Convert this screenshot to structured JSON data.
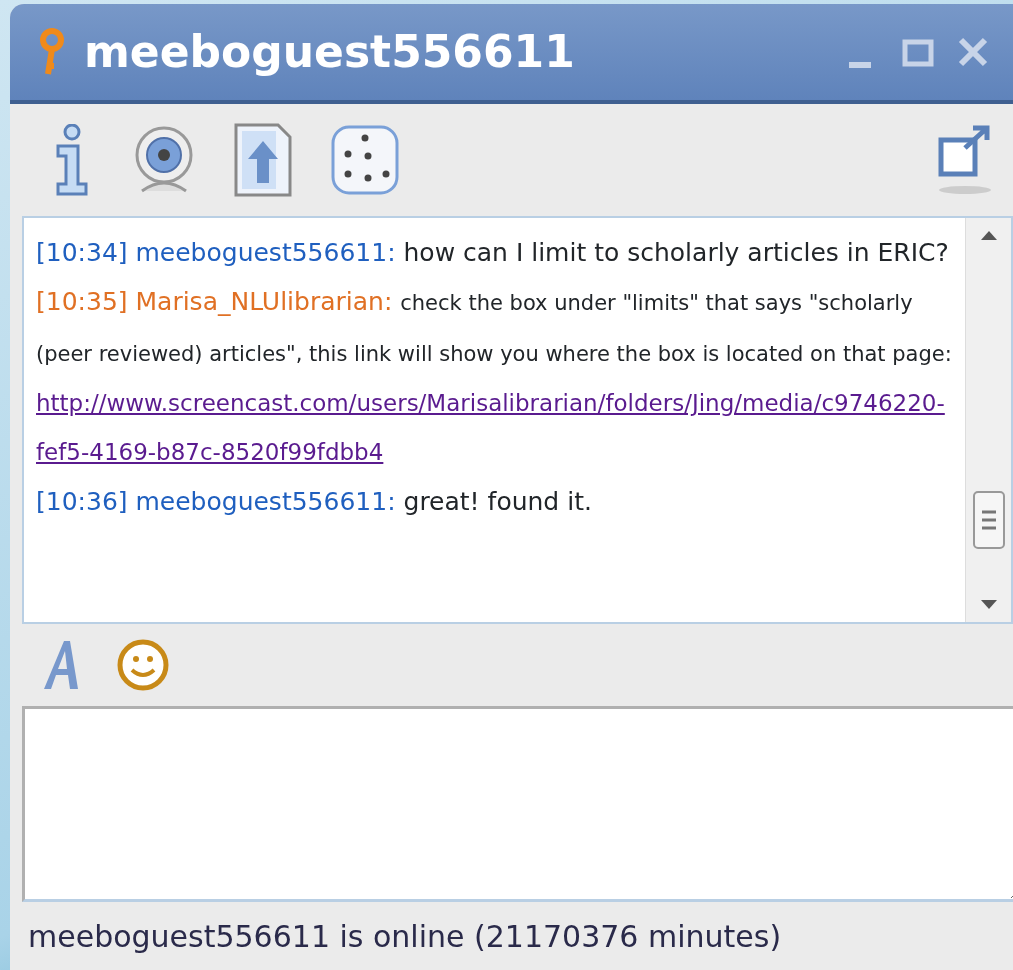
{
  "window": {
    "title": "meeboguest556611",
    "controls": [
      {
        "kind": "minimize"
      },
      {
        "kind": "maximize"
      },
      {
        "kind": "close"
      }
    ]
  },
  "messages": [
    {
      "time": "[10:34]",
      "sender": "meeboguest556611:",
      "kind": "guest",
      "text": "how can I limit to scholarly articles in ERIC?"
    },
    {
      "time": "[10:35]",
      "sender": "Marisa_NLUlibrarian:",
      "kind": "librarian",
      "text": "check the box under \"limits\" that says \"scholarly (peer reviewed) articles\", this link will show you where the box is located on that page:",
      "link": "http://www.screencast.com/users/Marisalibrarian/folders/Jing/media/c9746220-fef5-4169-b87c-8520f99fdbb4"
    },
    {
      "time": "[10:36]",
      "sender": "meeboguest556611:",
      "kind": "guest",
      "text": "great! found it."
    }
  ],
  "status_bar": "meeboguest556611 is online (21170376 minutes)"
}
